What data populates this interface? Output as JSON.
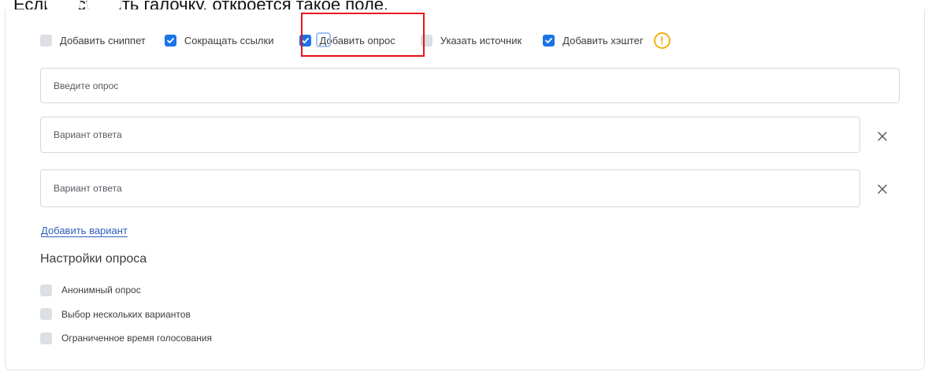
{
  "caption": "Если поставить галочку, откроется такое поле.",
  "options": [
    {
      "key": "snippet",
      "label": "Добавить сниппет",
      "checked": false
    },
    {
      "key": "shorten",
      "label": "Сокращать ссылки",
      "checked": true
    },
    {
      "key": "poll",
      "label": "Добавить опрос",
      "checked": true
    },
    {
      "key": "source",
      "label": "Указать источник",
      "checked": false
    },
    {
      "key": "hashtag",
      "label": "Добавить хэштег",
      "checked": true
    }
  ],
  "warning_icon": "exclamation-circle-icon",
  "poll": {
    "question_placeholder": "Введите опрос",
    "answers": [
      {
        "placeholder": "Вариант ответа"
      },
      {
        "placeholder": "Вариант ответа"
      }
    ],
    "add_variant_label": "Добавить вариант"
  },
  "settings": {
    "title": "Настройки опроса",
    "items": [
      {
        "label": "Анонимный опрос",
        "checked": false
      },
      {
        "label": "Выбор нескольких вариантов",
        "checked": false
      },
      {
        "label": "Ограниченное время голосования",
        "checked": false
      }
    ]
  },
  "colors": {
    "accent": "#1a73e8",
    "highlight": "#e8121b",
    "warning": "#f3b10e",
    "link": "#2d5fb8"
  }
}
